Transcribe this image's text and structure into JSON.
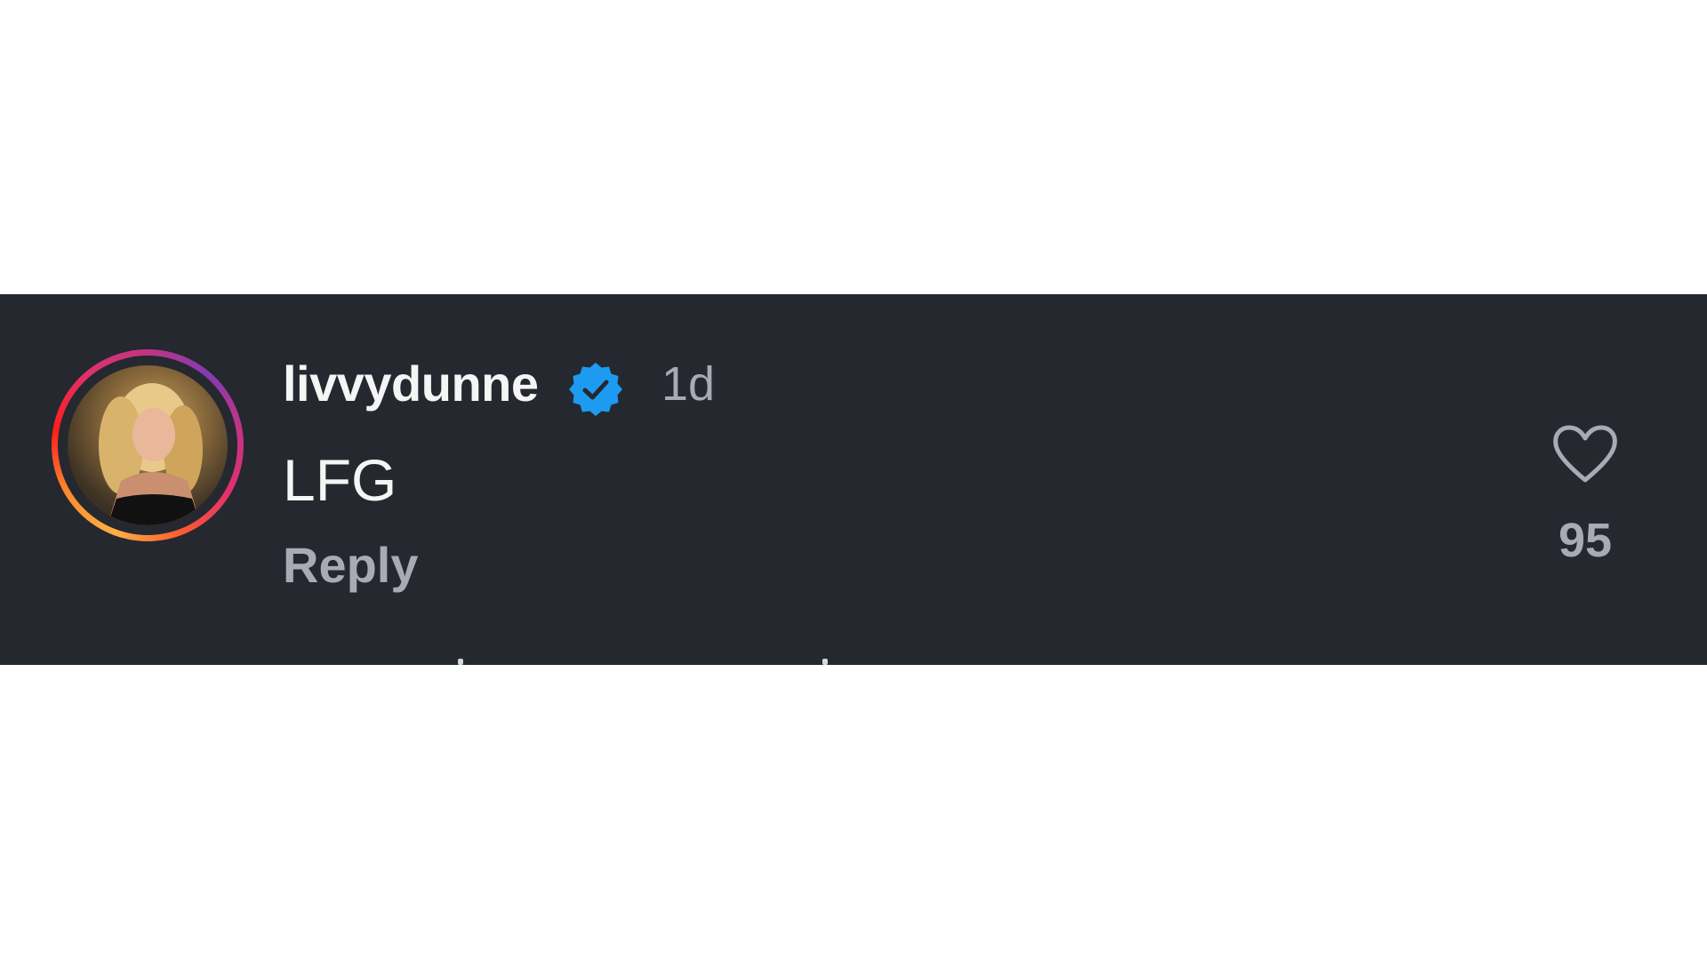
{
  "comment": {
    "username": "livvydunne",
    "verified_icon": "verified-badge-icon",
    "timestamp": "1d",
    "text": "LFG",
    "reply_label": "Reply",
    "like_icon": "heart-outline-icon",
    "like_count": "95"
  },
  "colors": {
    "background": "#25282e",
    "primary_text": "#f5f5f5",
    "secondary_text": "#a8abb3",
    "verified_blue": "#1d9bf0",
    "story_ring": [
      "#fcb045",
      "#fd1d1d",
      "#e1306c",
      "#c13584",
      "#833ab4"
    ]
  }
}
